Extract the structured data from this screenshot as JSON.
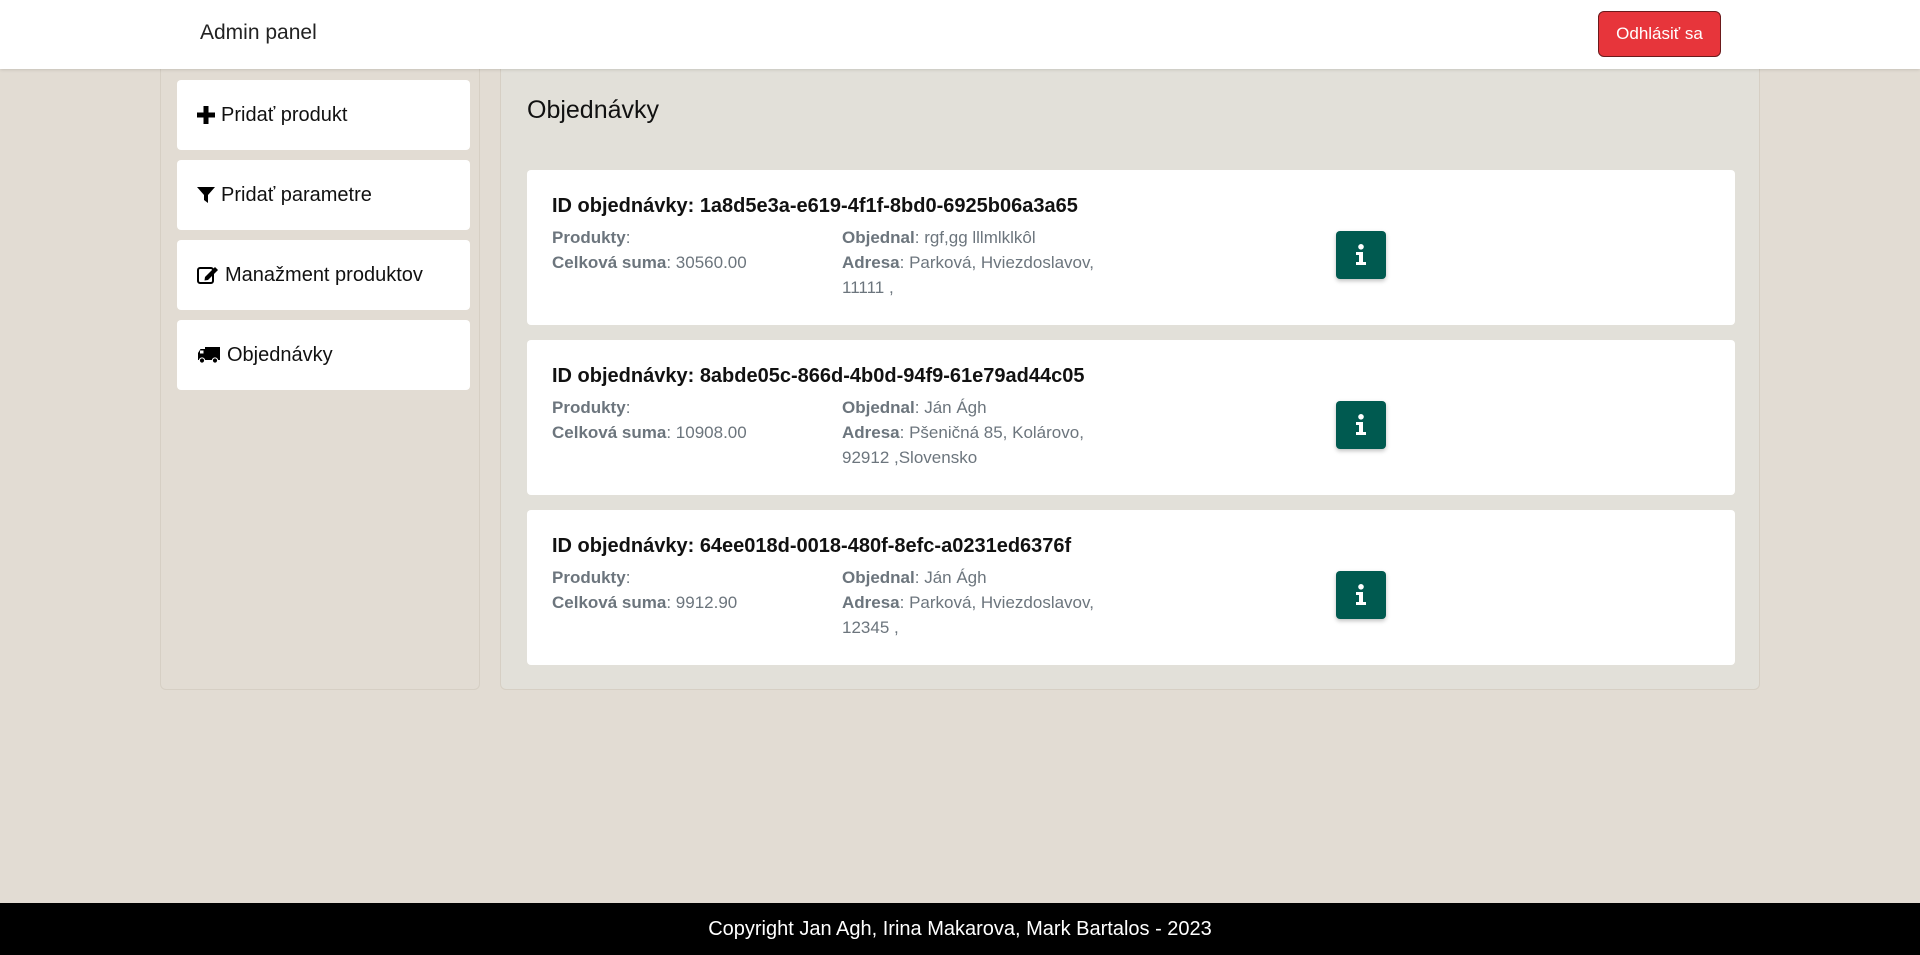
{
  "navbar": {
    "brand": "Admin panel",
    "logout_label": "Odhlásiť sa"
  },
  "sidebar": {
    "items": [
      {
        "label": "Pridať produkt",
        "icon": "plus-icon"
      },
      {
        "label": "Pridať parametre",
        "icon": "filter-icon"
      },
      {
        "label": "Manažment produktov",
        "icon": "edit-icon"
      },
      {
        "label": "Objednávky",
        "icon": "truck-icon"
      }
    ]
  },
  "main": {
    "title": "Objednávky",
    "labels": {
      "order_id": "ID objednávky: ",
      "products": "Produkty",
      "total": "Celková suma",
      "ordered_by": "Objednal",
      "address": "Adresa"
    },
    "orders": [
      {
        "id": "1a8d5e3a-e619-4f1f-8bd0-6925b06a3a65",
        "products": "",
        "total": "30560.00",
        "customer": "rgf,gg lllmlklkôl",
        "address": "Parková, Hviezdoslavov, 11111 ,"
      },
      {
        "id": "8abde05c-866d-4b0d-94f9-61e79ad44c05",
        "products": "",
        "total": "10908.00",
        "customer": "Ján Ágh",
        "address": "Pšeničná 85, Kolárovo, 92912 ,Slovensko"
      },
      {
        "id": "64ee018d-0018-480f-8efc-a0231ed6376f",
        "products": "",
        "total": "9912.90",
        "customer": "Ján Ágh",
        "address": "Parková, Hviezdoslavov, 12345 ,"
      }
    ]
  },
  "footer": {
    "text": "Copyright Jan Agh, Irina Makarova, Mark Bartalos - 2023"
  },
  "colors": {
    "logout": "#e7353b",
    "info_button": "#005a50",
    "page_background": "#e2dcd3"
  }
}
